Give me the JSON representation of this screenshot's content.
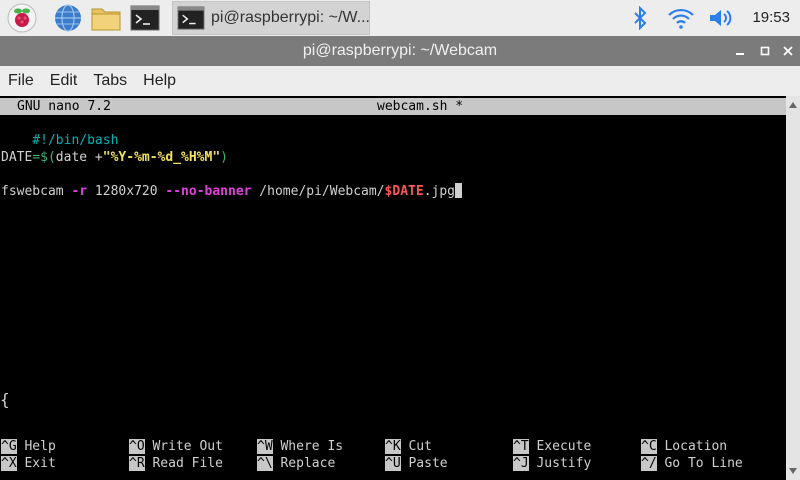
{
  "taskbar": {
    "icons": [
      "raspberry-icon",
      "globe-icon",
      "folder-icon",
      "terminal-icon"
    ],
    "active_task": "pi@raspberrypi: ~/W...",
    "tray": [
      "bluetooth-icon",
      "wifi-icon",
      "volume-icon"
    ],
    "clock": "19:53"
  },
  "window": {
    "title": "pi@raspberrypi: ~/Webcam"
  },
  "menubar": [
    "File",
    "Edit",
    "Tabs",
    "Help"
  ],
  "nano": {
    "version": "GNU nano 7.2",
    "filename": "webcam.sh *",
    "code": {
      "shebang": "#!/bin/bash",
      "l3_var": "DATE",
      "l3_eq": "=$(",
      "l3_cmd": "date +",
      "l3_str": "\"%Y-%m-%d_%H%M\"",
      "l3_close": ")",
      "l5_cmd": "fswebcam ",
      "l5_opt1": "-r",
      "l5_res": " 1280x720 ",
      "l5_opt2": "--no-banner",
      "l5_path": " /home/pi/Webcam/",
      "l5_var": "$DATE",
      "l5_ext": ".jpg"
    },
    "brace": "{",
    "shortcuts": [
      {
        "key": "^G",
        "label": "Help"
      },
      {
        "key": "^O",
        "label": "Write Out"
      },
      {
        "key": "^W",
        "label": "Where Is"
      },
      {
        "key": "^K",
        "label": "Cut"
      },
      {
        "key": "^T",
        "label": "Execute"
      },
      {
        "key": "^C",
        "label": "Location"
      },
      {
        "key": "^X",
        "label": "Exit"
      },
      {
        "key": "^R",
        "label": "Read File"
      },
      {
        "key": "^\\",
        "label": "Replace"
      },
      {
        "key": "^U",
        "label": "Paste"
      },
      {
        "key": "^J",
        "label": "Justify"
      },
      {
        "key": "^/",
        "label": "Go To Line"
      }
    ]
  },
  "colors": {
    "titlebar": "#7b7b7b",
    "terminal_bg": "#000000",
    "nano_bar": "#c7c7c7"
  }
}
